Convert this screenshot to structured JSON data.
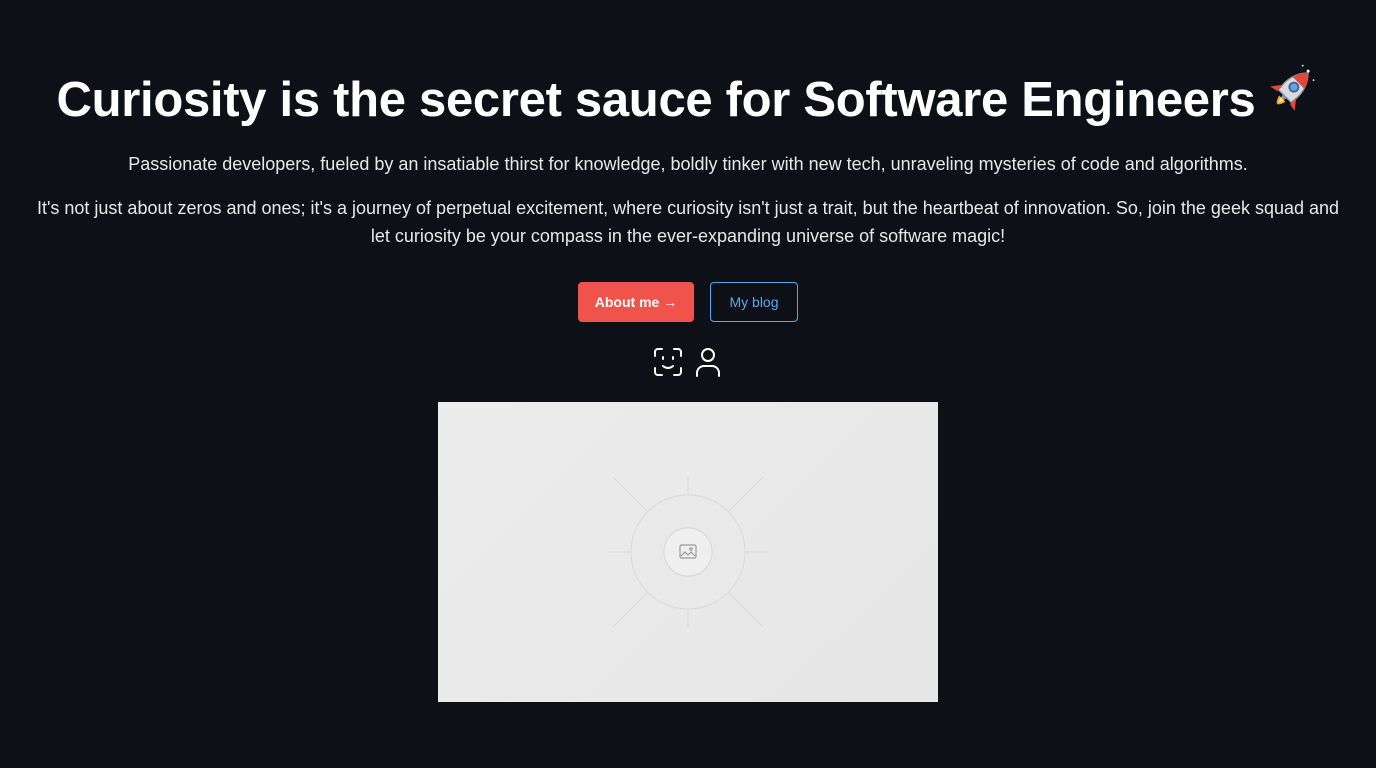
{
  "hero": {
    "headline": "Curiosity is the secret sauce for Software Engineers",
    "headline_emoji": "rocket",
    "paragraph_1": "Passionate developers, fueled by an insatiable thirst for knowledge, boldly tinker with new tech, unraveling mysteries of code and algorithms.",
    "paragraph_2": "It's not just about zeros and ones; it's a journey of perpetual excitement, where curiosity isn't just a trait, but the heartbeat of innovation. So, join the geek squad and let curiosity be your compass in the ever-expanding universe of software magic!"
  },
  "buttons": {
    "about_label": "About me →",
    "blog_label": "My blog"
  },
  "icons": [
    {
      "name": "face-scan-icon"
    },
    {
      "name": "user-icon"
    }
  ],
  "image": {
    "icon": "image-icon"
  },
  "colors": {
    "background": "#0d1117",
    "primary_button": "#f0534c",
    "secondary_button": "#5aa6f5",
    "text": "#ffffff"
  }
}
